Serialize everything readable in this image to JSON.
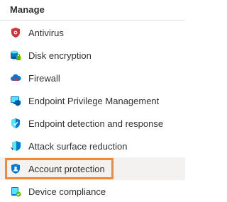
{
  "section": {
    "title": "Manage"
  },
  "nav": {
    "items": [
      {
        "label": "Antivirus",
        "icon": "antivirus-shield-icon"
      },
      {
        "label": "Disk encryption",
        "icon": "disk-encryption-icon"
      },
      {
        "label": "Firewall",
        "icon": "firewall-cloud-icon"
      },
      {
        "label": "Endpoint Privilege Management",
        "icon": "endpoint-privilege-icon"
      },
      {
        "label": "Endpoint detection and response",
        "icon": "endpoint-detection-shield-icon"
      },
      {
        "label": "Attack surface reduction",
        "icon": "attack-surface-shield-icon"
      },
      {
        "label": "Account protection",
        "icon": "account-protection-shield-icon"
      },
      {
        "label": "Device compliance",
        "icon": "device-compliance-icon"
      }
    ],
    "selected_index": 6
  },
  "colors": {
    "highlight": "#f7882f",
    "selected_bg": "#f3f2f1",
    "antivirus_red": "#d13438",
    "azure_blue": "#0078d4",
    "light_blue": "#50e6ff",
    "dark_blue": "#005ba1",
    "green": "#5db300"
  }
}
